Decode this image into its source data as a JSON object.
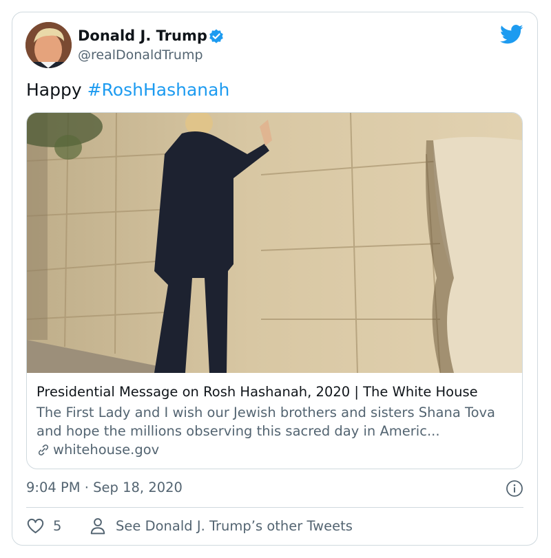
{
  "tweet": {
    "author": {
      "name": "Donald J. Trump",
      "handle": "@realDonaldTrump",
      "verified": true
    },
    "text_plain": "Happy",
    "hashtag": "#RoshHashanah",
    "link_card": {
      "title": "Presidential Message on Rosh Hashanah, 2020 | The White House",
      "description": "The First Lady and I wish our Jewish brothers and sisters Shana Tova and hope the millions observing this sacred day in Americ...",
      "domain": "whitehouse.gov"
    },
    "timestamp": "9:04 PM · Sep 18, 2020",
    "like_count": "5",
    "see_others_label": "See Donald J. Trump’s other Tweets"
  },
  "colors": {
    "accent": "#1d9bf0",
    "text": "#0f1419",
    "muted": "#536471",
    "border": "#cfd9de"
  },
  "icons": [
    "twitter-bird-icon",
    "verified-badge-icon",
    "link-icon",
    "info-icon",
    "heart-icon",
    "person-icon"
  ]
}
